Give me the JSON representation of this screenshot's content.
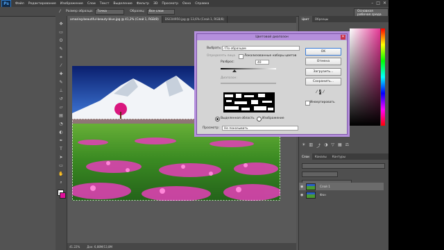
{
  "app": {
    "logo": "Ps"
  },
  "menu": [
    "Файл",
    "Редактирование",
    "Изображение",
    "Слои",
    "Текст",
    "Выделение",
    "Фильтр",
    "3D",
    "Просмотр",
    "Окно",
    "Справка"
  ],
  "options": {
    "sample_label": "Размер образца:",
    "sample_value": "Точка",
    "sample_layers_label": "Образец:",
    "sample_layers_value": "Все слои",
    "workspace": "Основная рабочая среда"
  },
  "tabs": [
    {
      "label": "amazing-beautiful-beauty-blue.jpg @ 41,2% (Слой 1, RGB/8)",
      "active": true
    },
    {
      "label": "DSC04950.jpg @ 13,6% (Слой 1, RGB/8)",
      "active": false
    }
  ],
  "status": {
    "zoom": "41.22%",
    "doc": "Док: 6,88M/13,8M"
  },
  "panels": {
    "top_tabs": [
      "Цвет",
      "Образцы"
    ],
    "layers_tabs": [
      "Слои",
      "Каналы",
      "Контуры"
    ],
    "layers": [
      {
        "name": "Слой 1"
      },
      {
        "name": "Фон"
      }
    ]
  },
  "dialog": {
    "title": "Цветовой диапазон",
    "select_label": "Выбрать:",
    "select_value": "По образцам",
    "detect_faces": "Определять лица",
    "localized": "Локализованные наборы цветов",
    "fuzziness_label": "Разброс:",
    "fuzziness_value": "40",
    "range_label": "Диапазон:",
    "range_value": "",
    "radio_selection": "Выделенная область",
    "radio_image": "Изображение",
    "preview_label": "Просмотр:",
    "preview_value": "Не показывать",
    "ok": "OK",
    "cancel": "Отмена",
    "load": "Загрузить...",
    "save": "Сохранить...",
    "invert": "Инвертировать"
  },
  "colors": {
    "accent": "#b48fdc",
    "canvas": "#595959",
    "panel": "#4f4f4f"
  }
}
